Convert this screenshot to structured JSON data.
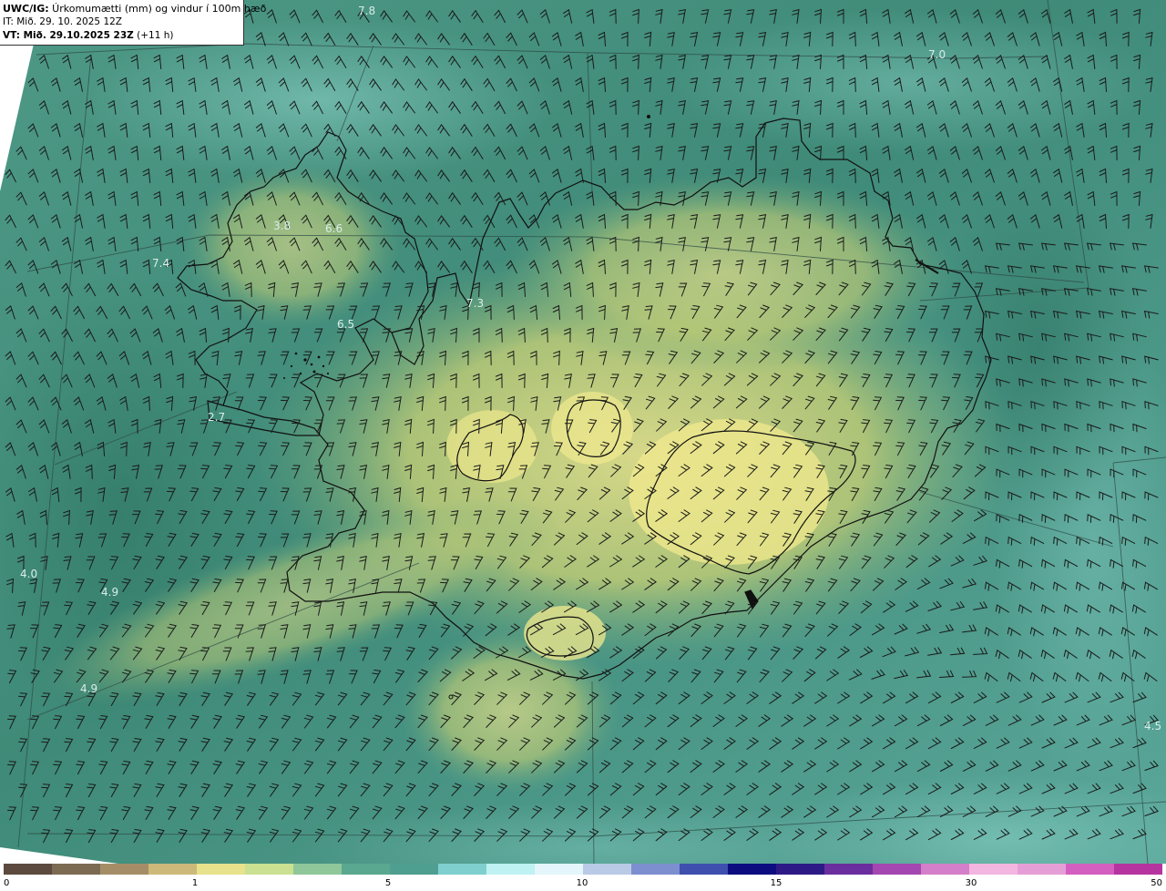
{
  "header": {
    "title_bold": "UWC/IG:",
    "title_rest": " Úrkomumætti (mm) og vindur í 100m hæð",
    "it_line": "IT: Mið. 29. 10. 2025 12Z",
    "vt_bold": "VT: Mið. 29.10.2025 23Z",
    "vt_rest": " (+11 h)"
  },
  "value_labels": [
    {
      "id": "nw-top",
      "text": "7.8"
    },
    {
      "id": "ne-top",
      "text": "7.0"
    },
    {
      "id": "westfjords-a",
      "text": "3.8"
    },
    {
      "id": "westfjords-b",
      "text": "6.6"
    },
    {
      "id": "west-sea",
      "text": "7.4"
    },
    {
      "id": "north-west",
      "text": "7.3"
    },
    {
      "id": "breidafjordur",
      "text": "6.5"
    },
    {
      "id": "snaefellsnes",
      "text": "2.7"
    },
    {
      "id": "sw-sea-a",
      "text": "4.0"
    },
    {
      "id": "sw-sea-b",
      "text": "4.9"
    },
    {
      "id": "sw-sea-c",
      "text": "4.9"
    },
    {
      "id": "se-sea",
      "text": "4.5"
    }
  ],
  "colorbar": {
    "colors": [
      "#5c4a3e",
      "#7d6a52",
      "#a58e67",
      "#cdb97a",
      "#e8e28c",
      "#cbe091",
      "#8fc79a",
      "#5aa88f",
      "#4f9f91",
      "#7fcfcf",
      "#bff2f2",
      "#e4f6fb",
      "#b9cae6",
      "#7d8fcf",
      "#3e4fae",
      "#0d0d80",
      "#2d1a86",
      "#6a2e9e",
      "#a447b0",
      "#d47fc9",
      "#f2b6e1",
      "#e69fd6",
      "#d35fc0",
      "#b5349f"
    ],
    "ticks": [
      {
        "label": "0",
        "value": 0
      },
      {
        "label": "1",
        "value": 1
      },
      {
        "label": "5",
        "value": 5
      },
      {
        "label": "10",
        "value": 10
      },
      {
        "label": "15",
        "value": 15
      },
      {
        "label": "30",
        "value": 30
      },
      {
        "label": "50",
        "value": 50
      }
    ]
  }
}
